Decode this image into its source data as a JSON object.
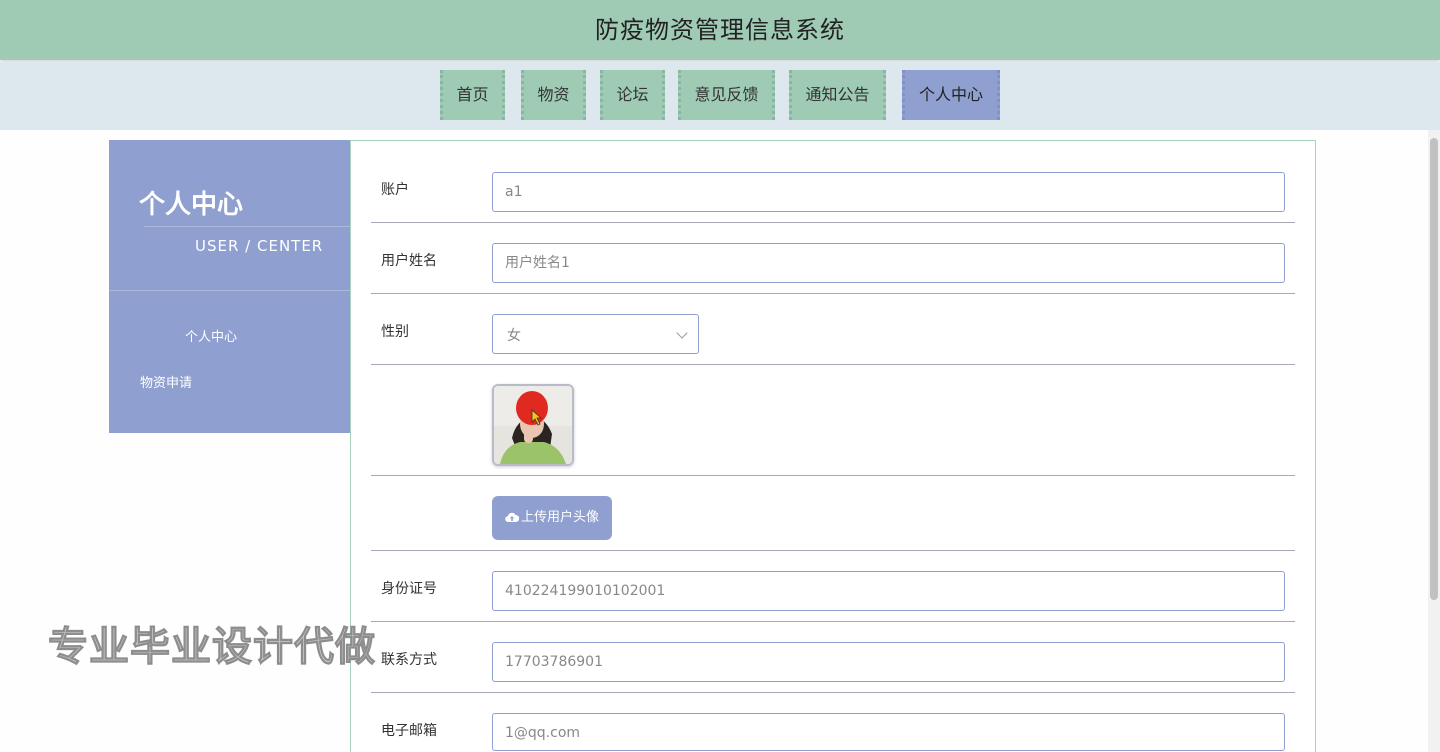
{
  "header": {
    "title": "防疫物资管理信息系统"
  },
  "nav": {
    "items": [
      {
        "label": "首页"
      },
      {
        "label": "物资"
      },
      {
        "label": "论坛"
      },
      {
        "label": "意见反馈"
      },
      {
        "label": "通知公告"
      },
      {
        "label": "个人中心",
        "active": true
      }
    ]
  },
  "sidebar": {
    "title": "个人中心",
    "subtitle": "USER / CENTER",
    "items": [
      {
        "label": "个人中心"
      },
      {
        "label": "物资申请"
      }
    ]
  },
  "form": {
    "account": {
      "label": "账户",
      "value": "a1"
    },
    "username": {
      "label": "用户姓名",
      "value": "用户姓名1"
    },
    "gender": {
      "label": "性别",
      "value": "女"
    },
    "upload_button": "上传用户头像",
    "id_number": {
      "label": "身份证号",
      "value": "410224199010102001"
    },
    "phone": {
      "label": "联系方式",
      "value": "17703786901"
    },
    "email": {
      "label": "电子邮箱",
      "value": "1@qq.com"
    }
  },
  "watermark": "专业毕业设计代做",
  "colors": {
    "header_bg": "#9fcbb4",
    "nav_bg": "#dce7ee",
    "accent": "#8f9fd0",
    "nav_item_bg": "#9fcbb4"
  }
}
